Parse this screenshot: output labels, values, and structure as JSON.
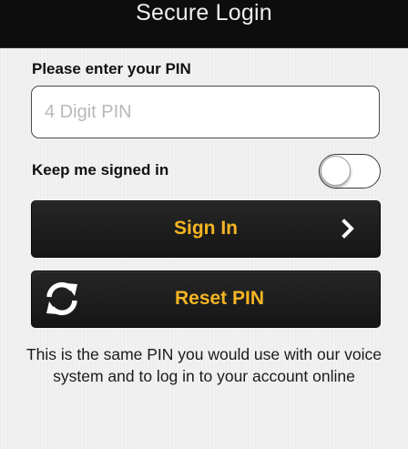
{
  "header": {
    "title": "Secure Login"
  },
  "form": {
    "pin_label": "Please enter your PIN",
    "pin_value": "",
    "pin_placeholder": "4 Digit PIN",
    "keep_signed_in_label": "Keep me signed in",
    "keep_signed_in": false
  },
  "buttons": {
    "sign_in_label": "Sign In",
    "sign_in_icon": "chevron-right-icon",
    "reset_label": "Reset PIN",
    "reset_icon": "refresh-icon"
  },
  "info_text": "This is the same PIN you would use with our voice system and to log in to your account online",
  "colors": {
    "accent": "#f5b523",
    "header_background": "#0d0d0d",
    "button_background": "#1e1e1e"
  }
}
